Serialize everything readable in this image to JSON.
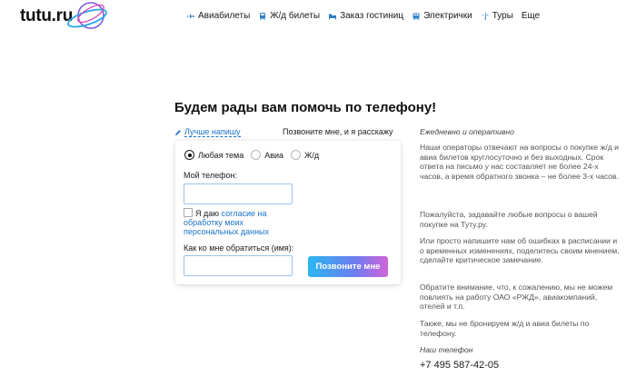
{
  "logo": {
    "text": "tutu.ru"
  },
  "nav": [
    {
      "icon": "plane-icon",
      "label": "Авиабилеты"
    },
    {
      "icon": "train-icon",
      "label": "Ж/д билеты"
    },
    {
      "icon": "bed-icon",
      "label": "Заказ гостиниц"
    },
    {
      "icon": "suburban-train-icon",
      "label": "Электрички"
    },
    {
      "icon": "palm-icon",
      "label": "Туры"
    },
    {
      "icon": "",
      "label": "Еще"
    }
  ],
  "page": {
    "title": "Будем рады вам помочь по телефону!"
  },
  "tabs": {
    "write": "Лучше напишу",
    "call": "Позвоните мне, и я расскажу"
  },
  "form": {
    "topics": [
      {
        "label": "Любая тема",
        "selected": true
      },
      {
        "label": "Авиа",
        "selected": false
      },
      {
        "label": "Ж/д",
        "selected": false
      }
    ],
    "phone_label": "Мой телефон:",
    "phone_value": "",
    "agree_prefix": "Я даю",
    "agree_link": "согласие на обработку моих персональных данных",
    "name_label": "Как ко мне обратиться (имя):",
    "name_value": "",
    "submit": "Позвоните мне"
  },
  "info": {
    "heading": "Ежедневно и оперативно",
    "p1": "Наши операторы отвечают на вопросы о покупке ж/д и авиа билетов круглосуточно и без выходных. Срок ответа на письмо у нас составляет не более 24-х часов, а время обратного звонка – не более 3-х часов.",
    "p2": "Пожалуйста, задавайте любые вопросы о вашей покупке на Туту.ру.",
    "p3": "Или просто напишите нам об ошибках в расписании и о временных изменениях, поделитесь своим мнением, сделайте критическое замечание.",
    "p4": "Обратите внимание, что, к сожалению, мы не можем повлиять на работу ОАО «РЖД», авиакомпаний, отелей и т.п.",
    "p5": "Также, мы не бронируем ж/д и авиа билеты по телефону.",
    "phone_heading": "Наш телефон",
    "phone": "+7 495 587-42-05"
  },
  "colors": {
    "link": "#1a73c9",
    "input_border": "#9cc3e9",
    "button_gradient": [
      "#2ab6f0",
      "#6f7cf0",
      "#d163d8"
    ]
  }
}
